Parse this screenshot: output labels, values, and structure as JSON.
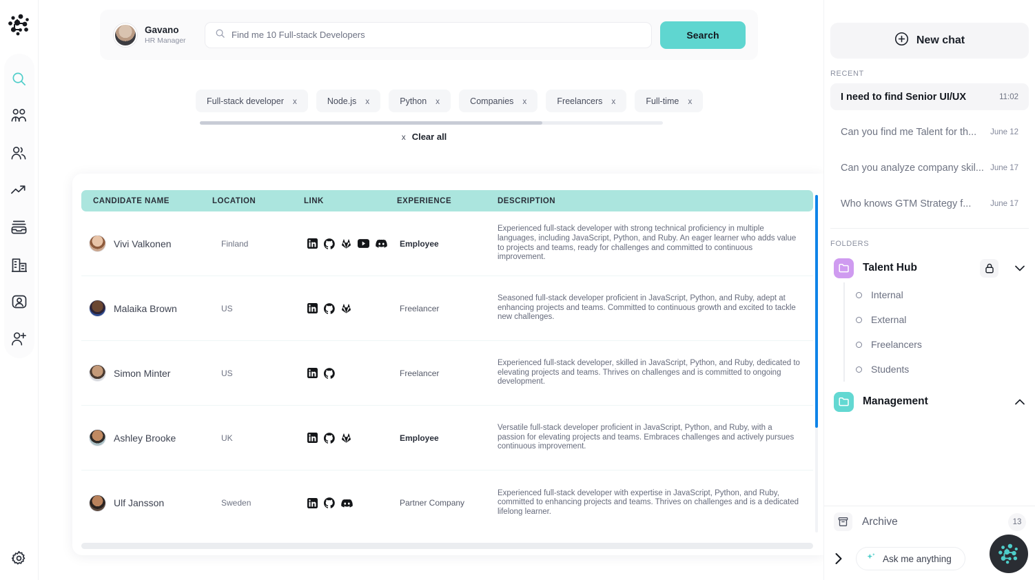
{
  "left_rail": {
    "logo": "network-logo",
    "items": [
      {
        "name": "search",
        "icon": "search-icon",
        "active": true
      },
      {
        "name": "teams",
        "icon": "people-group-icon",
        "active": false
      },
      {
        "name": "contacts",
        "icon": "users-icon",
        "active": false
      },
      {
        "name": "analytics",
        "icon": "trending-up-icon",
        "active": false
      },
      {
        "name": "inbox",
        "icon": "inbox-icon",
        "active": false
      },
      {
        "name": "companies",
        "icon": "building-icon",
        "active": false
      },
      {
        "name": "profile",
        "icon": "user-card-icon",
        "active": false
      },
      {
        "name": "invite",
        "icon": "add-user-icon",
        "active": false
      }
    ],
    "settings": {
      "name": "settings",
      "icon": "gear-icon"
    }
  },
  "header": {
    "user": {
      "name": "Gavano",
      "role": "HR Manager",
      "avatar": "user-avatar"
    },
    "search": {
      "icon": "search-icon",
      "value": "Find me 10 Full-stack Developers",
      "placeholder": "Find me 10 Full-stack Developers"
    },
    "search_button": "Search"
  },
  "filters": {
    "chips": [
      {
        "label": "Full-stack developer",
        "remove": "x"
      },
      {
        "label": "Node.js",
        "remove": "x"
      },
      {
        "label": "Python",
        "remove": "x"
      },
      {
        "label": "Companies",
        "remove": "x"
      },
      {
        "label": "Freelancers",
        "remove": "x"
      },
      {
        "label": "Full-time",
        "remove": "x"
      }
    ],
    "clear_all": {
      "label": "Clear all",
      "icon": "x"
    }
  },
  "table": {
    "columns": [
      "CANDIDATE NAME",
      "LOCATION",
      "LINK",
      "EXPERIENCE",
      "DESCRIPTION"
    ],
    "header_color": "#abe5de",
    "rows": [
      {
        "name": "Vivi Valkonen",
        "location": "Finland",
        "links": [
          "linkedin-icon",
          "github-icon",
          "gitlab-icon",
          "youtube-icon",
          "discord-icon"
        ],
        "experience": "Employee",
        "experience_bold": true,
        "description": "Experienced full-stack developer with strong technical proficiency in multiple languages, including JavaScript, Python, and Ruby. An eager learner who adds value to projects and teams, ready for challenges and committed to continuous improvement."
      },
      {
        "name": "Malaika Brown",
        "location": "US",
        "links": [
          "linkedin-icon",
          "github-icon",
          "gitlab-icon"
        ],
        "experience": "Freelancer",
        "experience_bold": false,
        "description": "Seasoned full-stack developer proficient in JavaScript, Python, and Ruby, adept at enhancing projects and teams. Committed to continuous growth and excited to tackle new challenges."
      },
      {
        "name": "Simon Minter",
        "location": "US",
        "links": [
          "linkedin-icon",
          "github-icon"
        ],
        "experience": "Freelancer",
        "experience_bold": false,
        "description": "Experienced full-stack developer, skilled in JavaScript, Python, and Ruby, dedicated to elevating projects and teams. Thrives on challenges and is committed to ongoing development."
      },
      {
        "name": "Ashley Brooke",
        "location": "UK",
        "links": [
          "linkedin-icon",
          "github-icon",
          "gitlab-icon"
        ],
        "experience": "Employee",
        "experience_bold": true,
        "description": "Versatile full-stack developer proficient in JavaScript, Python, and Ruby, with a passion for elevating projects and teams. Embraces challenges and actively pursues continuous improvement."
      },
      {
        "name": "Ulf Jansson",
        "location": "Sweden",
        "links": [
          "linkedin-icon",
          "github-icon",
          "discord-icon"
        ],
        "experience": "Partner Company",
        "experience_bold": false,
        "description": "Experienced full-stack developer with expertise in JavaScript, Python, and Ruby, committed to enhancing projects and teams. Thrives on challenges and is a dedicated lifelong learner."
      }
    ]
  },
  "right_panel": {
    "new_chat": {
      "label": "New chat",
      "icon": "plus-circle-icon"
    },
    "recent_label": "RECENT",
    "chats": [
      {
        "title": "I need to find Senior UI/UX",
        "time": "11:02",
        "selected": true
      },
      {
        "title": "Can you find me Talent for th...",
        "time": "June 12",
        "selected": false
      },
      {
        "title": "Can you analyze company skil...",
        "time": "June 17",
        "selected": false
      },
      {
        "title": "Who knows GTM Strategy f...",
        "time": "June 17",
        "selected": false
      }
    ],
    "folders_label": "FOLDERS",
    "folders": [
      {
        "name": "Talent Hub",
        "color": "#cf9bf0",
        "locked": true,
        "lock_icon": "lock-icon",
        "chevron": "chevron-down-icon",
        "expanded": true,
        "children": [
          "Internal",
          "External",
          "Freelancers",
          "Students"
        ]
      },
      {
        "name": "Management",
        "color": "#63d8d2",
        "locked": false,
        "chevron": "chevron-up-icon",
        "expanded": false,
        "children": []
      }
    ],
    "archive": {
      "label": "Archive",
      "count": "13",
      "icon": "archive-box-icon"
    },
    "bottom": {
      "expand_icon": "chevron-right-icon",
      "ask_label": "Ask me anything",
      "ask_icon": "sparkle-icon",
      "fab_icon": "network-logo"
    }
  }
}
